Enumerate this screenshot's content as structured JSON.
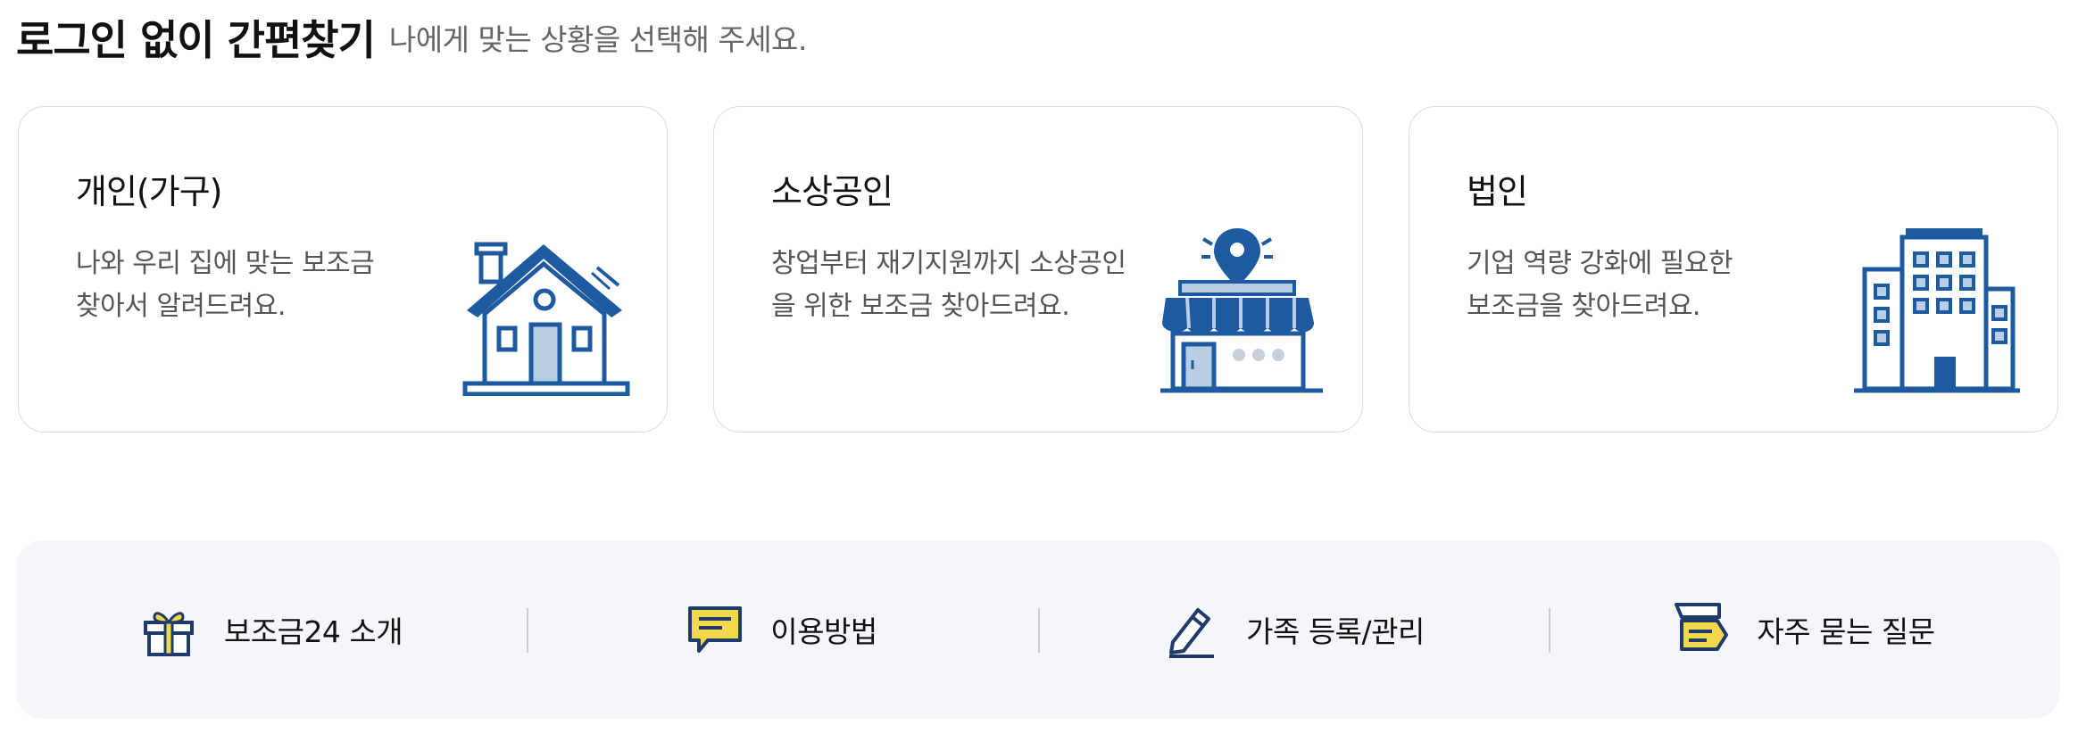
{
  "header": {
    "title": "로그인 없이 간편찾기",
    "subtitle": "나에게 맞는 상황을 선택해 주세요."
  },
  "cards": [
    {
      "title": "개인(가구)",
      "desc_line1": "나와 우리 집에 맞는 보조금",
      "desc_line2": "찾아서 알려드려요.",
      "icon": "house-icon"
    },
    {
      "title": "소상공인",
      "desc_line1": "창업부터 재기지원까지 소상공인",
      "desc_line2": "을 위한 보조금 찾아드려요.",
      "icon": "store-location-icon"
    },
    {
      "title": "법인",
      "desc_line1": "기업 역량 강화에 필요한",
      "desc_line2": "보조금을 찾아드려요.",
      "icon": "office-building-icon"
    }
  ],
  "quick_links": [
    {
      "label": "보조금24 소개",
      "icon": "gift-icon"
    },
    {
      "label": "이용방법",
      "icon": "chat-bubble-icon"
    },
    {
      "label": "가족 등록/관리",
      "icon": "pencil-icon"
    },
    {
      "label": "자주 묻는 질문",
      "icon": "faq-icon"
    }
  ],
  "colors": {
    "primary_blue": "#1e5aa0",
    "light_blue": "#b9cde4",
    "accent_yellow": "#f2d84b",
    "navy": "#1f3a6b",
    "card_border": "#d9dce3",
    "quick_bar_bg": "#f4f6fa"
  }
}
